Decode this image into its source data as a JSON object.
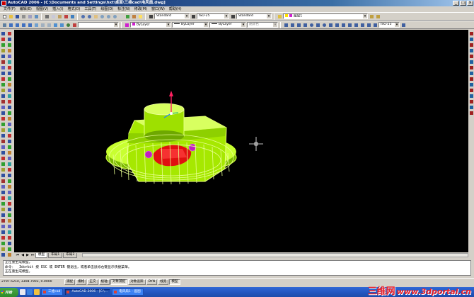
{
  "window": {
    "title": "AutoCAD 2006 - [C:\\Documents and Settings\\hxt\\桌面\\三维cad\\电风扇.dwg]",
    "controls": [
      "_",
      "□",
      "×"
    ]
  },
  "menu": [
    "文件(F)",
    "编辑(E)",
    "视图(V)",
    "插入(I)",
    "格式(O)",
    "工具(T)",
    "绘图(D)",
    "标注(N)",
    "修改(M)",
    "窗口(W)",
    "帮助(H)"
  ],
  "toolbar1": {
    "text_style": "Standard",
    "dim_style": "ISO-25",
    "table_style": "Standard",
    "layer": "图层1"
  },
  "toolbar2": {
    "color": "ByLayer",
    "linetype": "ByLayer",
    "lineweight": "ByLayer",
    "plot_style": "随颜色",
    "dim_style_right": "ISO-25"
  },
  "tabs": [
    "模型",
    "布局1",
    "布局2"
  ],
  "command_history": [
    "正在重生成模型。",
    "命令： _3dorbit 按 ESC 或 ENTER 键退出，或者单击鼠标右键显示快捷菜单。",
    "正在重生成模型。"
  ],
  "status": {
    "coords": "2797.5214, 3308.7903, 0.0000",
    "buttons": [
      {
        "label": "捕捉",
        "on": false
      },
      {
        "label": "栅格",
        "on": false
      },
      {
        "label": "正交",
        "on": false
      },
      {
        "label": "极轴",
        "on": false
      },
      {
        "label": "对象捕捉",
        "on": true
      },
      {
        "label": "对象追踪",
        "on": false
      },
      {
        "label": "DYN",
        "on": false
      },
      {
        "label": "线宽",
        "on": false
      },
      {
        "label": "模型",
        "on": true
      }
    ]
  },
  "taskbar": {
    "start": "开始",
    "tasks": [
      {
        "label": "三维cad",
        "active": false
      },
      {
        "label": "AutoCAD 2006 - [C:\\...",
        "active": true
      },
      {
        "label": "电风扇1 - 画图",
        "active": false
      }
    ]
  },
  "watermark": {
    "cn": "三维网",
    "en": "www.3dportal.cn"
  },
  "colors": {
    "viewport_bg": "#000000",
    "model_green": "#9ef000",
    "model_red": "#e01010",
    "model_magenta": "#c020c0"
  }
}
